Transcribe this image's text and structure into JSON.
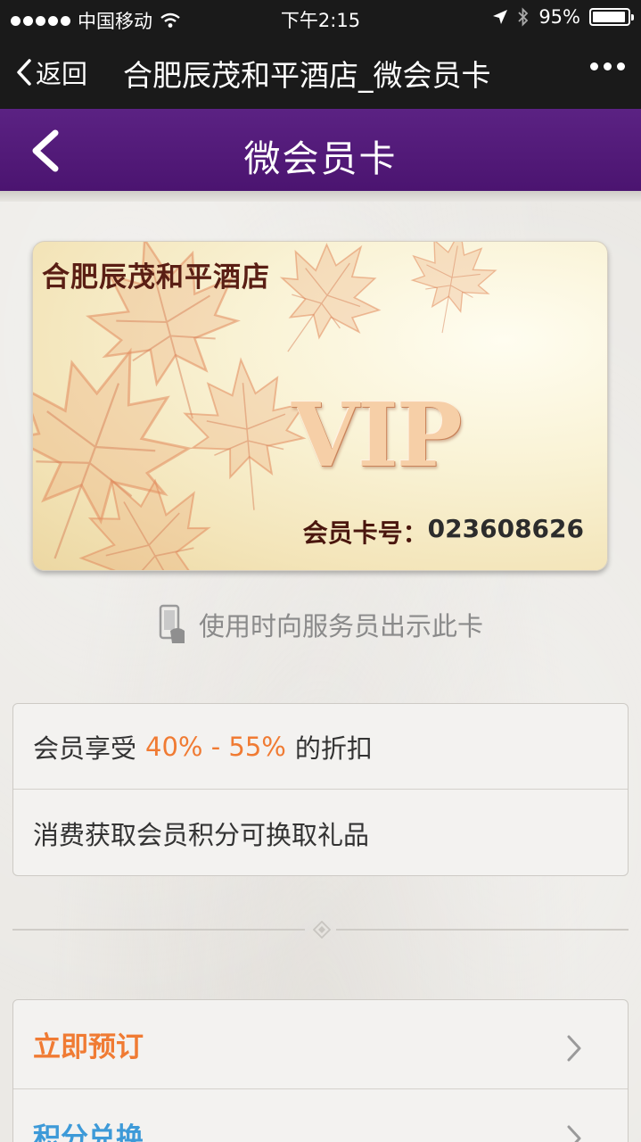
{
  "status_bar": {
    "carrier": "中国移动",
    "time": "下午2:15",
    "battery": "95%",
    "battery_level": 0.95
  },
  "wechat_nav": {
    "back_label": "返回",
    "title": "合肥辰茂和平酒店_微会员卡"
  },
  "page": {
    "title": "微会员卡"
  },
  "card": {
    "hotel_name": "合肥辰茂和平酒店",
    "badge": "VIP",
    "number_label": "会员卡号：",
    "number": "023608626"
  },
  "hint": {
    "text": "使用时向服务员出示此卡"
  },
  "benefits": {
    "discount_prefix": "会员享受",
    "discount_value": "40% - 55%",
    "discount_suffix": "的折扣",
    "points_text": "消费获取会员积分可换取礼品"
  },
  "actions": [
    {
      "label": "立即预订"
    },
    {
      "label": "积分兑换"
    }
  ],
  "colors": {
    "topbar": "#1a1a1a",
    "purple": "#5b2283",
    "orange": "#f07b33",
    "blue": "#3d9ad8",
    "card_text": "#5a1e14"
  }
}
